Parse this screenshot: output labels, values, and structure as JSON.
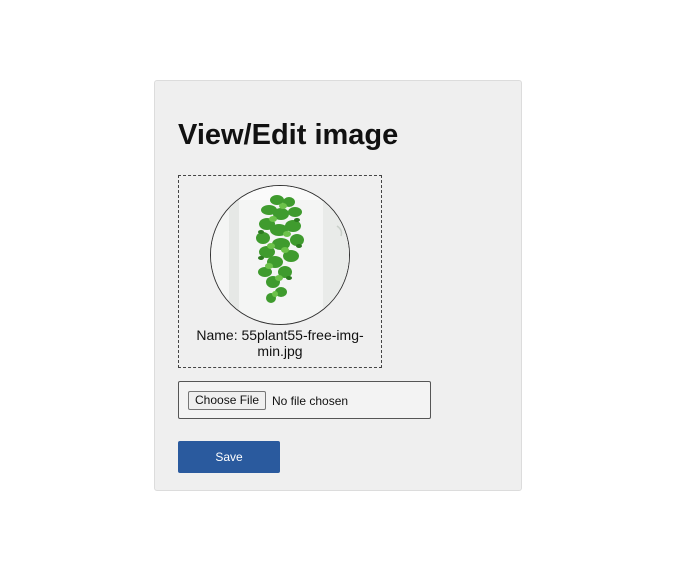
{
  "page": {
    "title": "View/Edit image"
  },
  "preview": {
    "name_label": "Name: 55plant55-free-img-min.jpg",
    "image_subject": "hanging-plant-photo"
  },
  "file_input": {
    "button_label": "Choose File",
    "status_text": "No file chosen"
  },
  "actions": {
    "save_label": "Save"
  },
  "colors": {
    "card_background": "#efefef",
    "save_button": "#2a5a9e",
    "page_background": "#ffffff"
  }
}
